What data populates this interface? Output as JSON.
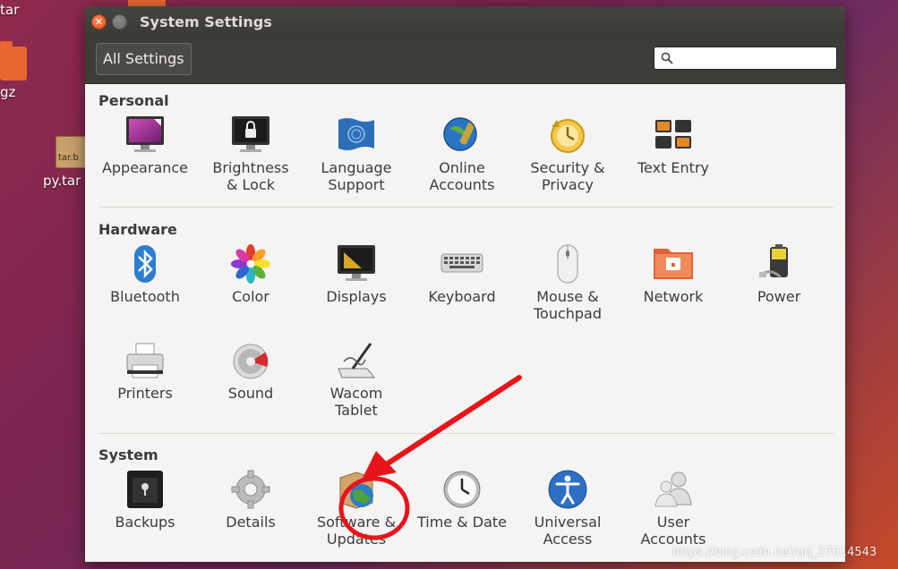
{
  "window": {
    "title": "System Settings",
    "all_settings_label": "All Settings",
    "search": {
      "value": "",
      "placeholder": ""
    }
  },
  "desktop": {
    "labels": [
      "tar",
      "gz",
      "py.tar",
      "tar.b"
    ]
  },
  "sections": [
    {
      "title": "Personal",
      "items": [
        {
          "label": "Appearance",
          "icon": "appearance-icon"
        },
        {
          "label": "Brightness\n& Lock",
          "icon": "lock-icon"
        },
        {
          "label": "Language\nSupport",
          "icon": "language-flag-icon"
        },
        {
          "label": "Online\nAccounts",
          "icon": "online-accounts-icon"
        },
        {
          "label": "Security &\nPrivacy",
          "icon": "security-privacy-icon"
        },
        {
          "label": "Text Entry",
          "icon": "text-entry-icon"
        }
      ]
    },
    {
      "title": "Hardware",
      "items": [
        {
          "label": "Bluetooth",
          "icon": "bluetooth-icon"
        },
        {
          "label": "Color",
          "icon": "color-icon"
        },
        {
          "label": "Displays",
          "icon": "displays-icon"
        },
        {
          "label": "Keyboard",
          "icon": "keyboard-icon"
        },
        {
          "label": "Mouse &\nTouchpad",
          "icon": "mouse-icon"
        },
        {
          "label": "Network",
          "icon": "network-icon"
        },
        {
          "label": "Power",
          "icon": "power-icon"
        },
        {
          "label": "Printers",
          "icon": "printer-icon"
        },
        {
          "label": "Sound",
          "icon": "sound-icon"
        },
        {
          "label": "Wacom\nTablet",
          "icon": "wacom-tablet-icon"
        }
      ]
    },
    {
      "title": "System",
      "items": [
        {
          "label": "Backups",
          "icon": "backups-icon"
        },
        {
          "label": "Details",
          "icon": "details-gear-icon"
        },
        {
          "label": "Software &\nUpdates",
          "icon": "software-updates-icon"
        },
        {
          "label": "Time & Date",
          "icon": "clock-icon"
        },
        {
          "label": "Universal\nAccess",
          "icon": "universal-access-icon"
        },
        {
          "label": "User\nAccounts",
          "icon": "user-accounts-icon"
        }
      ]
    }
  ],
  "annotation": {
    "color": "#e8141c"
  },
  "watermark": "https://blog.csdn.net/qq_27614543"
}
